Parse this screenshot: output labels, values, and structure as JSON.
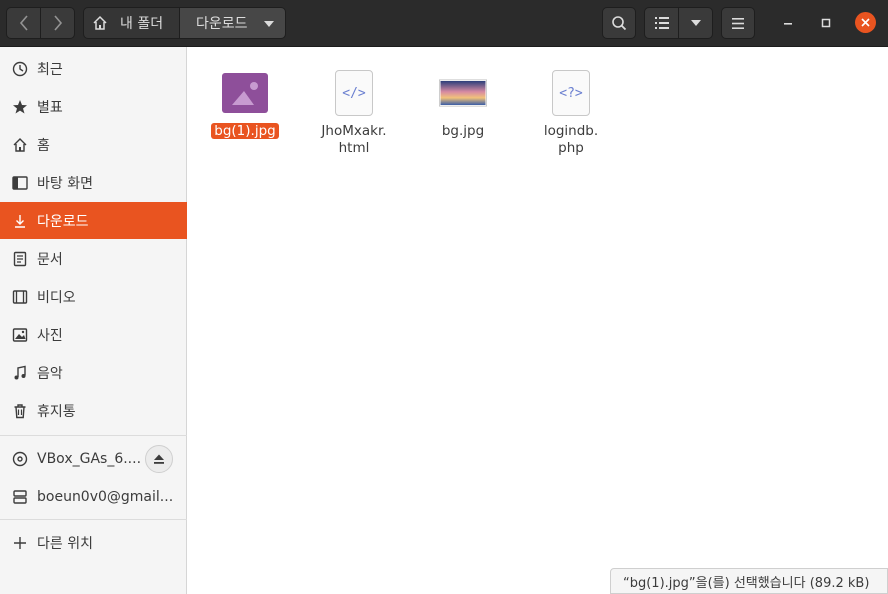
{
  "header": {
    "path_home_label": "내 폴더",
    "path_current_label": "다운로드",
    "icons": [
      "back-icon",
      "forward-icon",
      "home-icon",
      "search-icon",
      "list-view-icon",
      "menu-icon",
      "minimize-icon",
      "maximize-icon",
      "close-icon"
    ]
  },
  "sidebar": {
    "places": [
      {
        "label": "최근",
        "icon": "clock-icon"
      },
      {
        "label": "별표",
        "icon": "star-icon"
      },
      {
        "label": "홈",
        "icon": "home-icon"
      },
      {
        "label": "바탕 화면",
        "icon": "desktop-icon"
      },
      {
        "label": "다운로드",
        "icon": "download-icon",
        "active": true
      },
      {
        "label": "문서",
        "icon": "document-icon"
      },
      {
        "label": "비디오",
        "icon": "film-icon"
      },
      {
        "label": "사진",
        "icon": "picture-icon"
      },
      {
        "label": "음악",
        "icon": "music-icon"
      },
      {
        "label": "휴지통",
        "icon": "trash-icon"
      }
    ],
    "devices": [
      {
        "label": "VBox_GAs_6....",
        "icon": "disc-icon"
      },
      {
        "label": "boeun0v0@gmail...",
        "icon": "network-drive-icon"
      }
    ],
    "other_locations": {
      "label": "다른 위치",
      "icon": "plus-icon"
    }
  },
  "files": [
    {
      "name": "bg(1).jpg",
      "selected": true,
      "type": "image"
    },
    {
      "name": "JhoMxakr.html",
      "display": "JhoMxakr.\nhtml",
      "type": "html",
      "glyph": "</>"
    },
    {
      "name": "bg.jpg",
      "type": "photo"
    },
    {
      "name": "logindb.php",
      "display": "logindb.\nphp",
      "type": "php",
      "glyph": "<?>"
    }
  ],
  "statusbar": {
    "text": "“bg(1).jpg”을(를) 선택했습니다  (89.2 kB)"
  },
  "colors": {
    "accent": "#e95420",
    "header_bg": "#2b2b2b",
    "sidebar_bg": "#f5f5f5"
  }
}
